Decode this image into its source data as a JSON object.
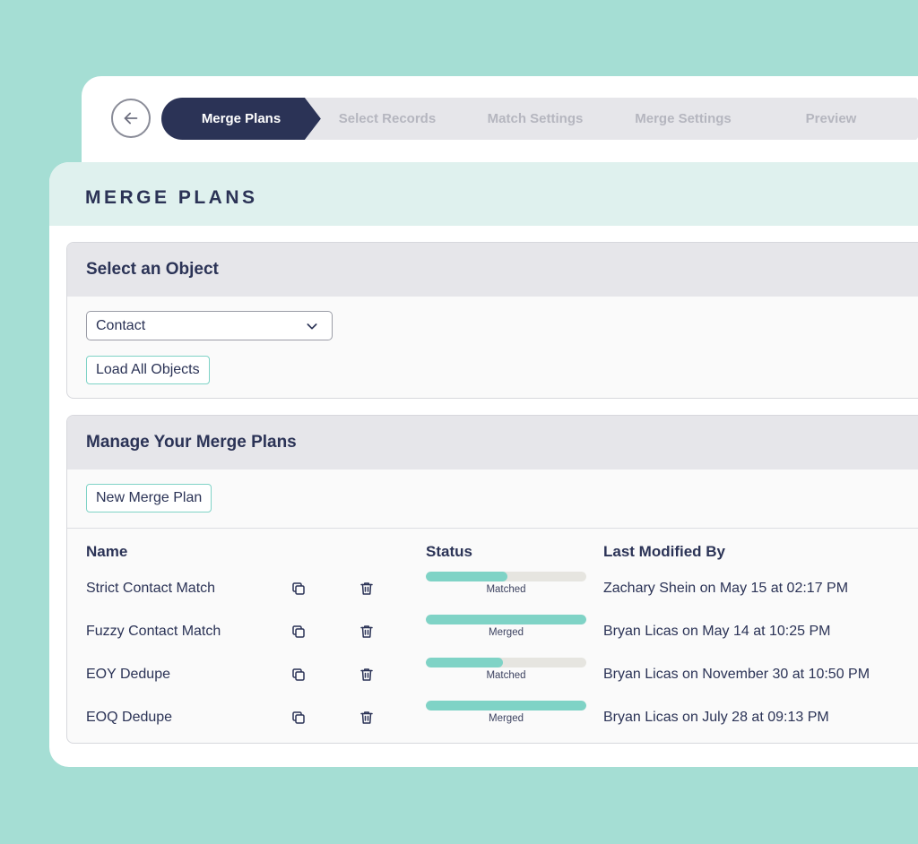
{
  "wizard": {
    "back_icon": "arrow-left-icon",
    "steps": [
      {
        "label": "Merge Plans",
        "active": true
      },
      {
        "label": "Select Records",
        "active": false
      },
      {
        "label": "Match Settings",
        "active": false
      },
      {
        "label": "Merge Settings",
        "active": false
      },
      {
        "label": "Preview",
        "active": false
      }
    ]
  },
  "page": {
    "title": "MERGE PLANS"
  },
  "select_object": {
    "heading": "Select an Object",
    "selected_value": "Contact",
    "load_button": "Load All Objects"
  },
  "manage_plans": {
    "heading": "Manage Your Merge Plans",
    "new_button": "New Merge Plan",
    "columns": {
      "name": "Name",
      "status": "Status",
      "modified": "Last Modified By"
    },
    "rows": [
      {
        "name": "Strict Contact Match",
        "status": "Matched",
        "progress": 0.51,
        "modified": "Zachary Shein on May 15 at 02:17 PM"
      },
      {
        "name": "Fuzzy Contact Match",
        "status": "Merged",
        "progress": 1.0,
        "modified": "Bryan Licas on May 14 at 10:25 PM"
      },
      {
        "name": "EOY Dedupe",
        "status": "Matched",
        "progress": 0.48,
        "modified": "Bryan Licas on November 30 at 10:50 PM"
      },
      {
        "name": "EOQ Dedupe",
        "status": "Merged",
        "progress": 1.0,
        "modified": "Bryan Licas on July 28 at 09:13 PM"
      }
    ]
  },
  "colors": {
    "navy": "#2b3356",
    "teal": "#7fd3c6",
    "background": "#a5ded4"
  }
}
